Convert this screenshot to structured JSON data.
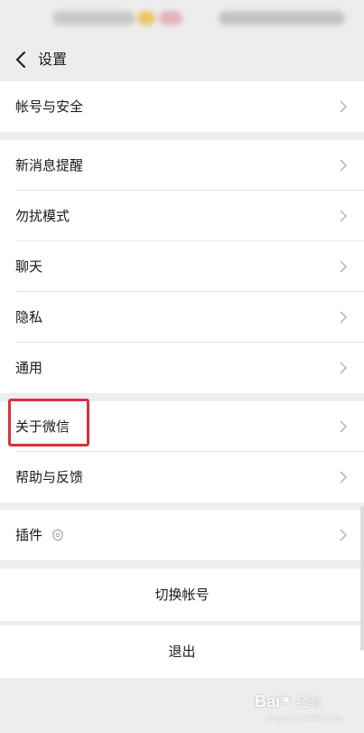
{
  "nav": {
    "title": "设置"
  },
  "groups": [
    {
      "items": [
        {
          "label": "帐号与安全"
        }
      ]
    },
    {
      "items": [
        {
          "label": "新消息提醒"
        },
        {
          "label": "勿扰模式"
        },
        {
          "label": "聊天"
        },
        {
          "label": "隐私"
        },
        {
          "label": "通用"
        }
      ]
    },
    {
      "items": [
        {
          "label": "关于微信"
        },
        {
          "label": "帮助与反馈"
        }
      ]
    },
    {
      "items": [
        {
          "label": "插件"
        }
      ]
    }
  ],
  "actions": {
    "switch_account": "切换帐号",
    "logout": "退出"
  },
  "watermark": {
    "brand_left": "Bai",
    "brand_right": "经验",
    "url": "jingyan.baidu.com"
  },
  "colors": {
    "background": "#ededed",
    "cell": "#ffffff",
    "highlight": "#d9303d"
  },
  "icons": {
    "back": "chevron-left-icon",
    "row": "chevron-right-icon",
    "plugin": "plugin-icon"
  }
}
